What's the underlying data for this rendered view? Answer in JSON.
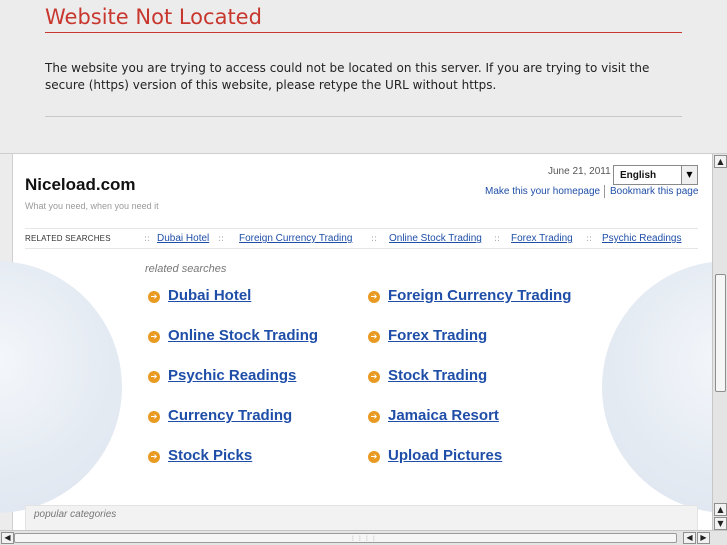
{
  "error": {
    "title": "Website Not Located",
    "message": "The website you are trying to access could not be located on this server. If you are trying to visit the secure (https) version of this website, please retype the URL without https."
  },
  "site": {
    "title": "Niceload.com",
    "tagline": "What you need, when you need it",
    "date": "June 21, 2011",
    "language": "English",
    "homepage_link": "Make this your homepage",
    "bookmark_link": "Bookmark this page"
  },
  "related_bar": {
    "label": "RELATED SEARCHES",
    "separator": "::",
    "links": [
      "Dubai Hotel",
      "Foreign Currency Trading",
      "Online Stock Trading",
      "Forex Trading",
      "Psychic Readings"
    ]
  },
  "results": {
    "label": "related searches",
    "bullet_glyph": "➔",
    "items": [
      "Dubai Hotel",
      "Foreign Currency Trading",
      "Online Stock Trading",
      "Forex Trading",
      "Psychic Readings",
      "Stock Trading",
      "Currency Trading",
      "Jamaica Resort",
      "Stock Picks",
      "Upload Pictures"
    ]
  },
  "popular": {
    "label": "popular categories"
  },
  "scrollbars": {
    "up_glyph": "▲",
    "down_glyph": "▼",
    "left_glyph": "◀",
    "right_glyph": "▶",
    "grip_glyph": "⋮⋮⋮⋮"
  },
  "colors": {
    "error_red": "#c8372e",
    "link_blue": "#1f4ea8",
    "bullet_orange": "#e99a22"
  }
}
